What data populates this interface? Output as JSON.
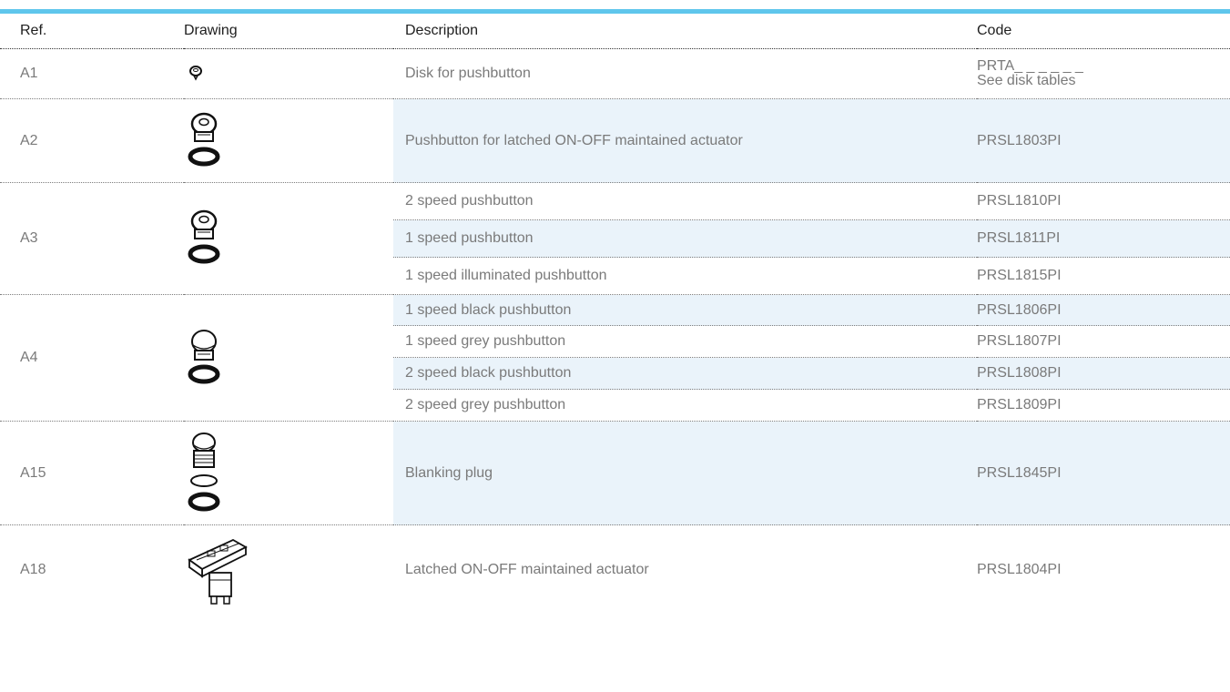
{
  "columns": {
    "ref": "Ref.",
    "drawing": "Drawing",
    "description": "Description",
    "code": "Code"
  },
  "groups": [
    {
      "ref": "A1",
      "drawing": "disk-icon",
      "rows": [
        {
          "description": "Disk for pushbutton",
          "code": "PRTA_ _ _ _ _ _",
          "code_note": "See disk tables",
          "shaded": false
        }
      ]
    },
    {
      "ref": "A2",
      "drawing": "pushbutton-with-ring-icon",
      "rows": [
        {
          "description": "Pushbutton for latched ON-OFF maintained actuator",
          "code": "PRSL1803PI",
          "shaded": true
        }
      ]
    },
    {
      "ref": "A3",
      "drawing": "pushbutton-with-ring-icon",
      "rows": [
        {
          "description": "2 speed pushbutton",
          "code": "PRSL1810PI",
          "shaded": false
        },
        {
          "description": "1 speed pushbutton",
          "code": "PRSL1811PI",
          "shaded": true
        },
        {
          "description": "1 speed illuminated pushbutton",
          "code": "PRSL1815PI",
          "shaded": false
        }
      ]
    },
    {
      "ref": "A4",
      "drawing": "mushroom-pushbutton-icon",
      "rows": [
        {
          "description": "1 speed black pushbutton",
          "code": "PRSL1806PI",
          "shaded": true
        },
        {
          "description": "1 speed grey pushbutton",
          "code": "PRSL1807PI",
          "shaded": false
        },
        {
          "description": "2 speed black pushbutton",
          "code": "PRSL1808PI",
          "shaded": true
        },
        {
          "description": "2 speed grey pushbutton",
          "code": "PRSL1809PI",
          "shaded": false
        }
      ]
    },
    {
      "ref": "A15",
      "drawing": "blanking-plug-icon",
      "rows": [
        {
          "description": "Blanking plug",
          "code": "PRSL1845PI",
          "shaded": true
        }
      ]
    },
    {
      "ref": "A18",
      "drawing": "actuator-icon",
      "rows": [
        {
          "description": "Latched ON-OFF maintained actuator",
          "code": "PRSL1804PI",
          "shaded": false
        }
      ]
    }
  ],
  "colors": {
    "accent": "#5fc6ec",
    "row_shade": "#eaf3fa",
    "header_text": "#1e1e1e",
    "body_text": "#7a7a7a"
  }
}
